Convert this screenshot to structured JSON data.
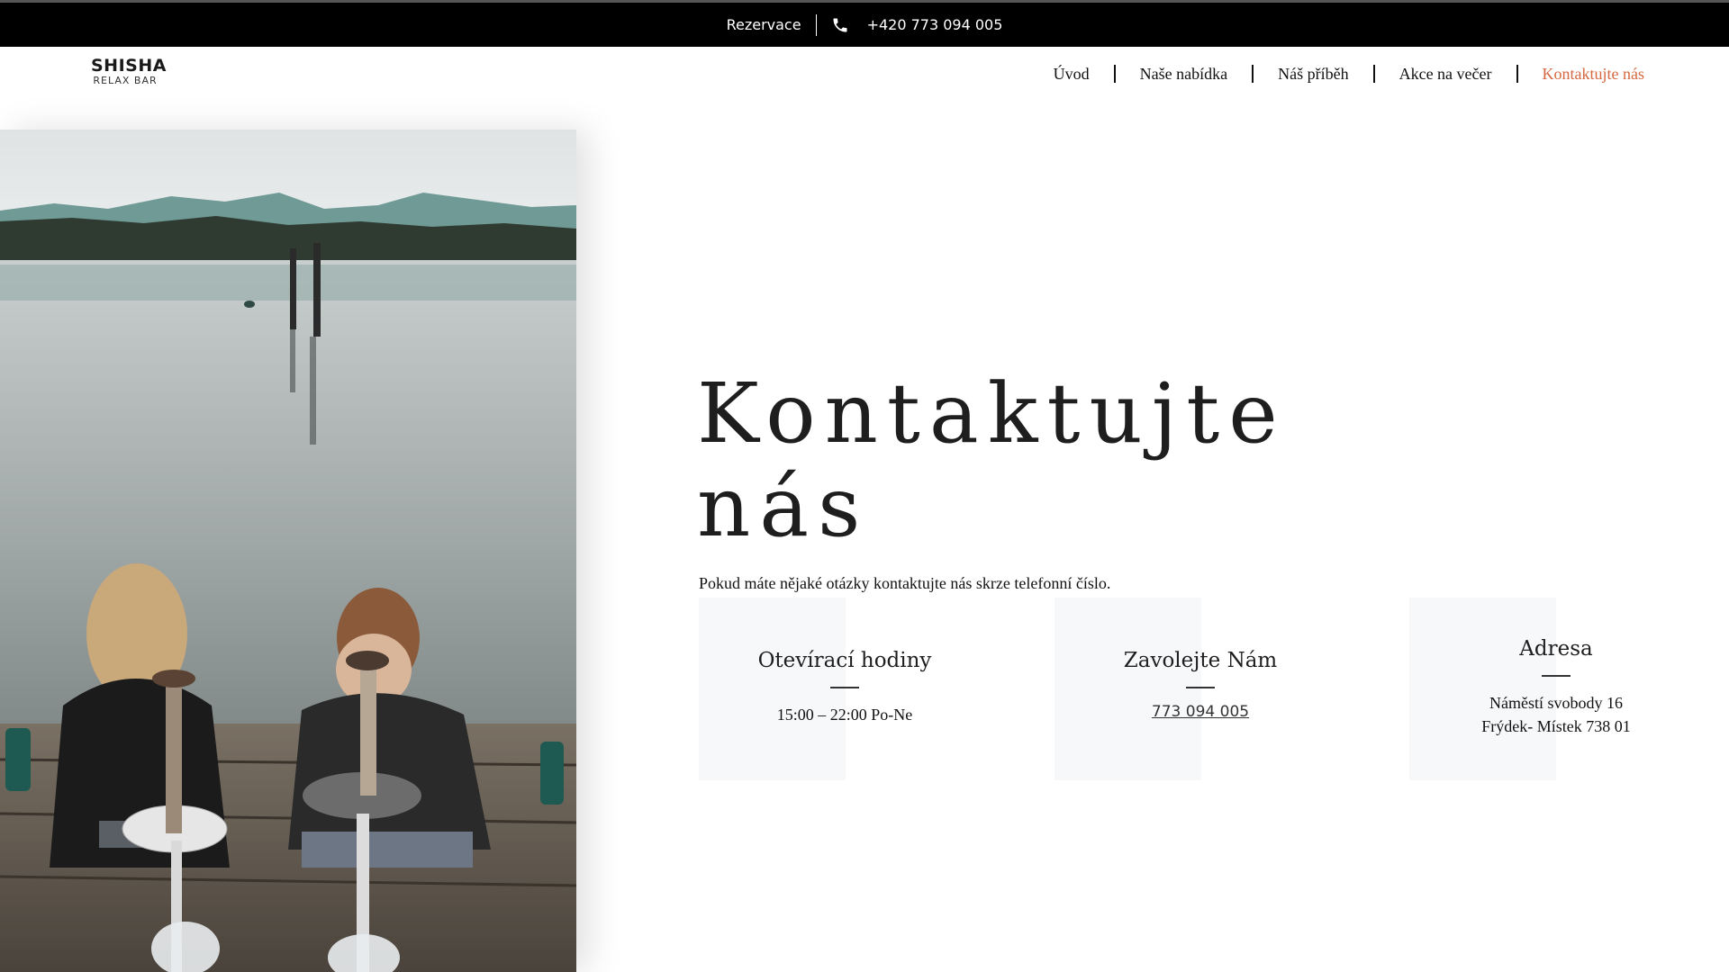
{
  "topbar": {
    "reservation_label": "Rezervace",
    "phone_icon": "phone-icon",
    "phone": "+420 773 094 005"
  },
  "header": {
    "logo_main": "SHISHA",
    "logo_sub": "RELAX BAR"
  },
  "nav": {
    "items": [
      {
        "label": "Úvod"
      },
      {
        "label": "Naše nabídka"
      },
      {
        "label": "Náš příběh"
      },
      {
        "label": "Akce na večer"
      },
      {
        "label": "Kontaktujte nás"
      }
    ],
    "active_color": "#d5683f"
  },
  "hero": {
    "title_line1": "Kontaktujte",
    "title_line2": "nás",
    "subtitle": "Pokud máte nějaké otázky kontaktujte nás skrze telefonní číslo."
  },
  "cards": [
    {
      "title": "Otevírací hodiny",
      "lines": [
        "15:00 – 22:00 Po-Ne"
      ]
    },
    {
      "title": "Zavolejte Nám",
      "link": "773 094 005"
    },
    {
      "title": "Adresa",
      "lines": [
        "Náměstí svobody 16",
        "Frýdek- Místek 738 01"
      ]
    }
  ]
}
